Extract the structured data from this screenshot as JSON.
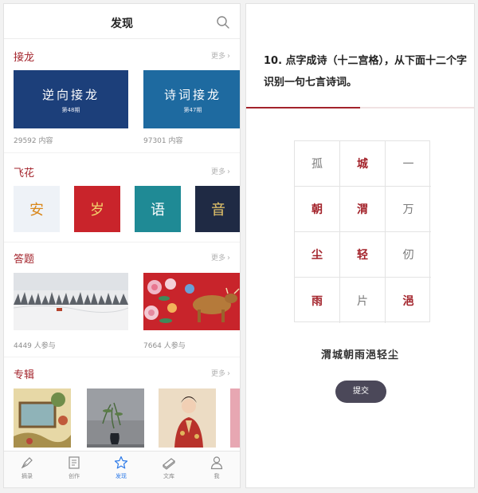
{
  "left": {
    "title": "发现",
    "more_label": "更多",
    "chevron": "›",
    "sections": {
      "jielong": {
        "title": "接龙",
        "cards": [
          {
            "title": "逆向接龙",
            "issue": "第48期",
            "caption": "29592 内容",
            "bg": "#1c3f7a"
          },
          {
            "title": "诗词接龙",
            "issue": "第47期",
            "caption": "97301 内容",
            "bg": "#1e6aa0"
          }
        ]
      },
      "feihua": {
        "title": "飞花",
        "cards": [
          {
            "char": "安",
            "bg": "#eef2f7",
            "color": "#d9871a"
          },
          {
            "char": "岁",
            "bg": "#c9242b",
            "color": "#f3d26c"
          },
          {
            "char": "语",
            "bg": "#1f8a95",
            "color": "#ffffff"
          },
          {
            "char": "音",
            "bg": "#1f2a44",
            "color": "#e7c66a"
          }
        ]
      },
      "dati": {
        "title": "答题",
        "cards": [
          {
            "caption": "4449 人参与"
          },
          {
            "caption": "7664 人参与"
          }
        ]
      },
      "zhuanji": {
        "title": "专辑"
      }
    },
    "tabs": [
      {
        "label": "摘录",
        "icon": "pen-nib-icon"
      },
      {
        "label": "创作",
        "icon": "document-icon"
      },
      {
        "label": "发现",
        "icon": "star-icon",
        "active": true
      },
      {
        "label": "文库",
        "icon": "books-icon"
      },
      {
        "label": "我",
        "icon": "person-icon"
      }
    ]
  },
  "right": {
    "question": "10. 点字成诗（十二宫格），从下面十二个字识别一句七言诗词。",
    "progress_fraction": 0.5,
    "grid": [
      {
        "char": "孤",
        "selected": false
      },
      {
        "char": "城",
        "selected": true
      },
      {
        "char": "一",
        "selected": false
      },
      {
        "char": "朝",
        "selected": true
      },
      {
        "char": "渭",
        "selected": true
      },
      {
        "char": "万",
        "selected": false
      },
      {
        "char": "尘",
        "selected": true
      },
      {
        "char": "轻",
        "selected": true
      },
      {
        "char": "仞",
        "selected": false
      },
      {
        "char": "雨",
        "selected": true
      },
      {
        "char": "片",
        "selected": false
      },
      {
        "char": "浥",
        "selected": true
      }
    ],
    "answer": "渭城朝雨浥轻尘",
    "submit_label": "提交"
  },
  "colors": {
    "accent_red": "#a3232b",
    "tab_active": "#2f7be8",
    "button_dark": "#4b4859"
  }
}
